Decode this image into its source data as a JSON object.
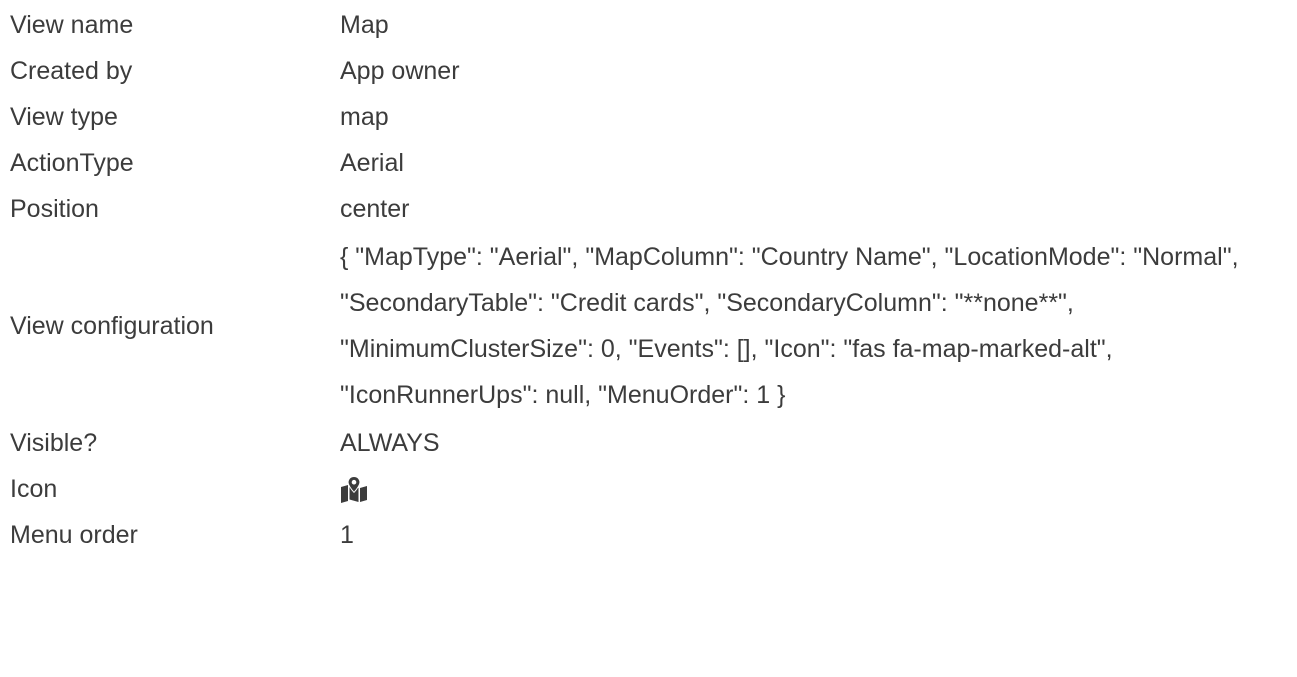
{
  "properties": {
    "view_name": {
      "label": "View name",
      "value": "Map"
    },
    "created_by": {
      "label": "Created by",
      "value": "App owner"
    },
    "view_type": {
      "label": "View type",
      "value": "map"
    },
    "action_type": {
      "label": "ActionType",
      "value": "Aerial"
    },
    "position": {
      "label": "Position",
      "value": "center"
    },
    "view_configuration": {
      "label": "View configuration",
      "value": "{ \"MapType\": \"Aerial\", \"MapColumn\": \"Country Name\", \"LocationMode\": \"Normal\", \"SecondaryTable\": \"Credit cards\", \"SecondaryColumn\": \"**none**\", \"MinimumClusterSize\": 0, \"Events\": [], \"Icon\": \"fas fa-map-marked-alt\", \"IconRunnerUps\": null, \"MenuOrder\": 1 }"
    },
    "visible": {
      "label": "Visible?",
      "value": "ALWAYS"
    },
    "icon": {
      "label": "Icon",
      "icon_name": "map-marked-alt-icon",
      "color": "#3c3c3c"
    },
    "menu_order": {
      "label": "Menu order",
      "value": "1"
    }
  },
  "colors": {
    "text": "#3c3c3c",
    "background": "#ffffff"
  }
}
